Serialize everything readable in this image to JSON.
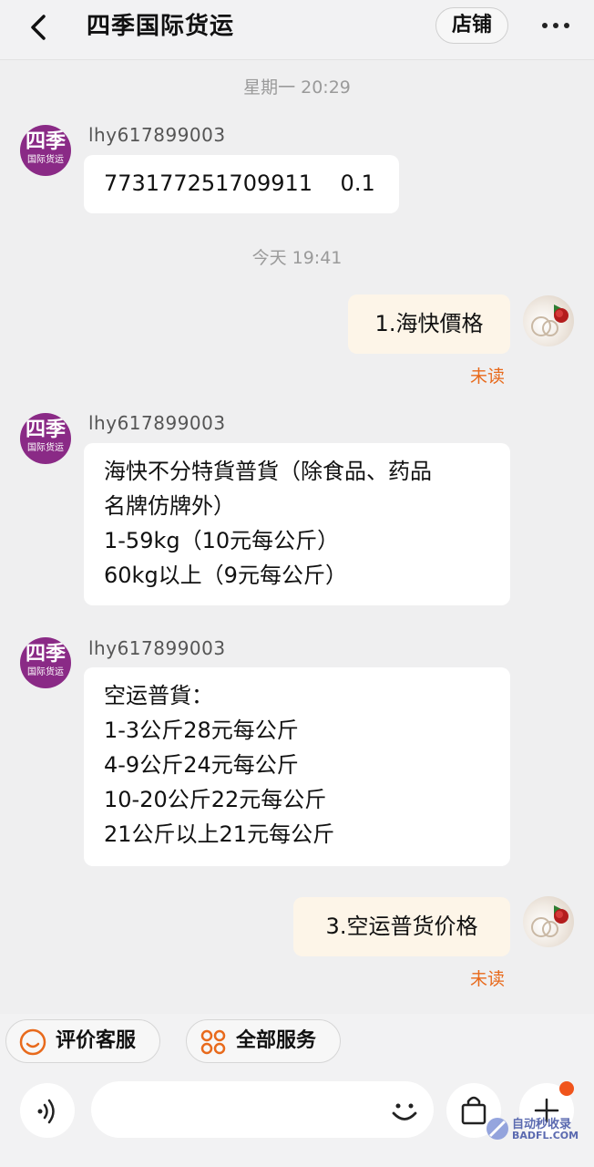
{
  "header": {
    "title": "四季国际货运",
    "store_label": "店铺"
  },
  "shop_avatar": {
    "big": "四季",
    "small": "国际货运"
  },
  "messages": {
    "sep1": "星期一 20:29",
    "msg1": {
      "sender": "lhy617899003",
      "text": "773177251709911    0.1"
    },
    "sep2": "今天 19:41",
    "msg2": {
      "text": "1.海快價格",
      "status": "未读"
    },
    "msg3": {
      "sender": "lhy617899003",
      "lines": [
        "海快不分特貨普貨（除食品、药品",
        "名牌仿牌外）",
        "1-59kg（10元每公斤）",
        "60kg以上（9元每公斤）"
      ]
    },
    "msg4": {
      "sender": "lhy617899003",
      "lines": [
        "空运普貨：",
        "1-3公斤28元每公斤",
        "4-9公斤24元每公斤",
        "10-20公斤22元每公斤",
        "21公斤以上21元每公斤"
      ]
    },
    "msg5": {
      "text": "3.空运普货价格",
      "status": "未读"
    }
  },
  "quick_actions": {
    "rate": "评价客服",
    "services": "全部服务"
  },
  "input": {
    "placeholder": ""
  },
  "watermark": {
    "line1": "自动秒收录",
    "line2": "BADFL.COM"
  },
  "colors": {
    "unread": "#e86a1c",
    "shop_avatar": "#8a2a86",
    "my_bubble": "#fdf5e8",
    "badge": "#f0541b"
  }
}
